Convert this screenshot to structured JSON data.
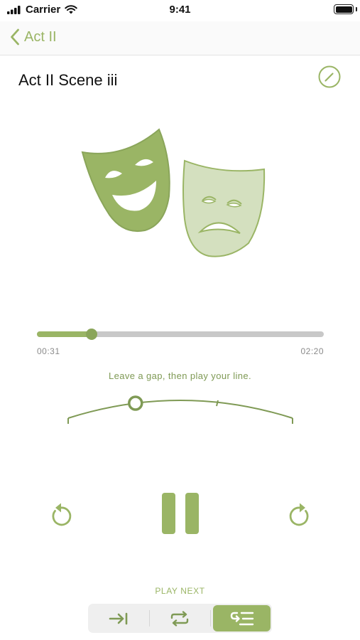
{
  "status_bar": {
    "carrier": "Carrier",
    "time": "9:41",
    "icons": [
      "signal-icon",
      "wifi-icon",
      "battery-icon"
    ]
  },
  "nav": {
    "back_label": "Act II",
    "back_icon": "chevron-left-icon"
  },
  "scene": {
    "title": "Act II Scene iii",
    "edit_icon": "pencil-circle-icon"
  },
  "artwork": {
    "icon": "theatre-masks-icon",
    "comedy_color": "#9ab565",
    "tragedy_color": "#d4e0bf"
  },
  "playback": {
    "elapsed": "00:31",
    "total": "02:20",
    "progress": 0.19
  },
  "gap": {
    "hint": "Leave a gap, then play your line.",
    "level": 0.3
  },
  "controls": {
    "rewind_icon": "rewind-icon",
    "pause_icon": "pause-icon",
    "forward_icon": "forward-icon"
  },
  "play_next": {
    "label": "PLAY NEXT",
    "options": [
      {
        "icon": "skip-to-end-icon",
        "active": false
      },
      {
        "icon": "repeat-icon",
        "active": false
      },
      {
        "icon": "queue-return-icon",
        "active": true
      }
    ]
  },
  "colors": {
    "accent": "#9ab565",
    "accent_dark": "#7f9a55",
    "track": "#c8c8c8",
    "muted_text": "#8a8a8a"
  }
}
